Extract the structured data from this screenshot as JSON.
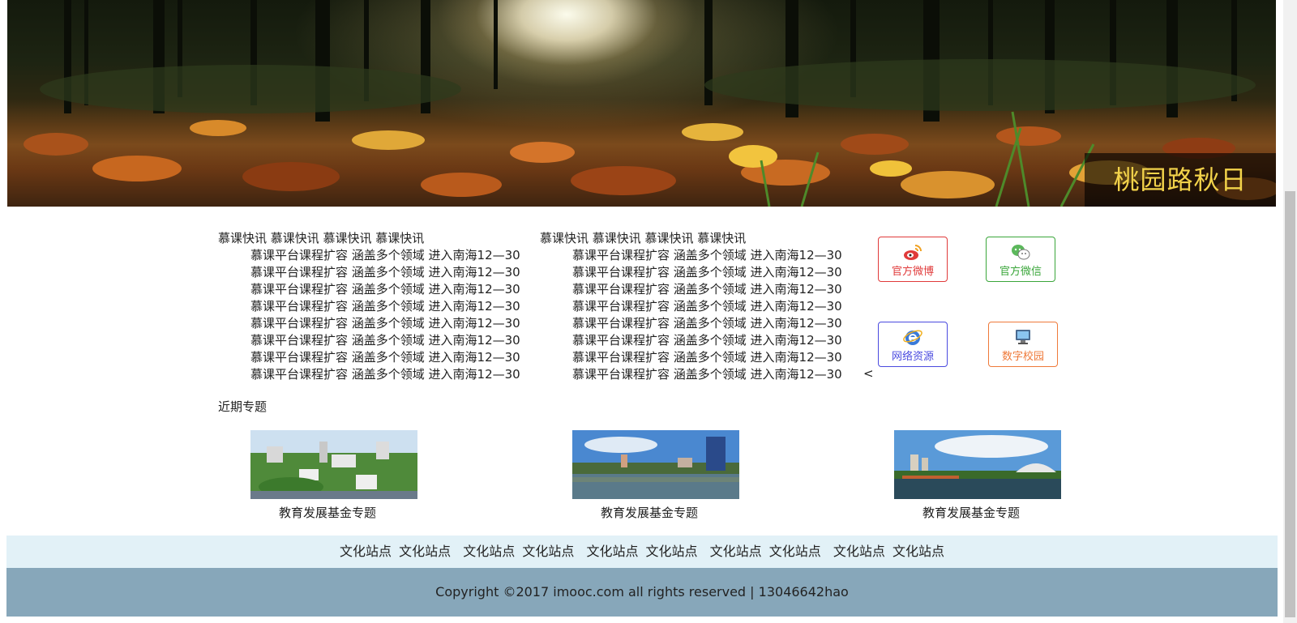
{
  "banner": {
    "caption": "桃园路秋日"
  },
  "news_left": {
    "heading": "慕课快讯 慕课快讯 慕课快讯 慕课快讯",
    "items": [
      "慕课平台课程扩容 涵盖多个领域 进入南海12—30",
      "慕课平台课程扩容 涵盖多个领域 进入南海12—30",
      "慕课平台课程扩容 涵盖多个领域 进入南海12—30",
      "慕课平台课程扩容 涵盖多个领域 进入南海12—30",
      "慕课平台课程扩容 涵盖多个领域 进入南海12—30",
      "慕课平台课程扩容 涵盖多个领域 进入南海12—30",
      "慕课平台课程扩容 涵盖多个领域 进入南海12—30",
      "慕课平台课程扩容 涵盖多个领域 进入南海12—30"
    ]
  },
  "news_right": {
    "heading": "慕课快讯 慕课快讯 慕课快讯 慕课快讯",
    "items": [
      "慕课平台课程扩容 涵盖多个领域 进入南海12—30",
      "慕课平台课程扩容 涵盖多个领域 进入南海12—30",
      "慕课平台课程扩容 涵盖多个领域 进入南海12—30",
      "慕课平台课程扩容 涵盖多个领域 进入南海12—30",
      "慕课平台课程扩容 涵盖多个领域 进入南海12—30",
      "慕课平台课程扩容 涵盖多个领域 进入南海12—30",
      "慕课平台课程扩容 涵盖多个领域 进入南海12—30",
      "慕课平台课程扩容 涵盖多个领域 进入南海12—30"
    ],
    "trailing_mark": "<"
  },
  "quick_links": {
    "weibo": {
      "label": "官方微博",
      "icon": "weibo-icon",
      "color": "#e03a3a"
    },
    "wechat": {
      "label": "官方微信",
      "icon": "wechat-icon",
      "color": "#3aa63a"
    },
    "web": {
      "label": "网络资源",
      "icon": "ie-icon",
      "color": "#4a4adf"
    },
    "campus": {
      "label": "数字校园",
      "icon": "monitor-icon",
      "color": "#ef7a3a"
    }
  },
  "topics": {
    "title": "近期专题",
    "items": [
      {
        "caption": "教育发展基金专题"
      },
      {
        "caption": "教育发展基金专题"
      },
      {
        "caption": "教育发展基金专题"
      }
    ]
  },
  "footer": {
    "sites": [
      "文化站点",
      "文化站点",
      "文化站点",
      "文化站点",
      "文化站点",
      "文化站点",
      "文化站点",
      "文化站点",
      "文化站点",
      "文化站点"
    ],
    "copyright": "Copyright ©2017 imooc.com all rights reserved | 13046642hao",
    "colors": {
      "site_bar": "#e2f1f7",
      "copyright_bar": "#87a7ba"
    }
  }
}
